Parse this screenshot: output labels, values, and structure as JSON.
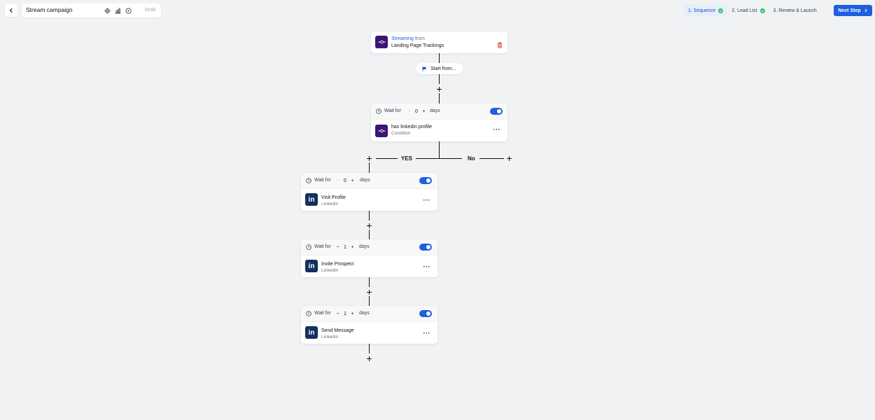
{
  "header": {
    "campaign_title": "Stream campaign",
    "status": "Draft",
    "steps": [
      {
        "label": "1. Sequence",
        "done": true,
        "active": true
      },
      {
        "label": "2. Lead List",
        "done": true,
        "active": false
      },
      {
        "label": "3. Review & Launch",
        "done": false,
        "active": false
      }
    ],
    "next_label": "Next Step"
  },
  "trigger": {
    "source_highlight": "Streaming",
    "source_suffix": "from",
    "source_name": "Landing Page Trackings",
    "start_label": "Start from..."
  },
  "condition": {
    "wait_label": "Wait for",
    "wait_value": "0",
    "wait_unit": "days",
    "title": "has linkedin profile",
    "subtitle": "Condition",
    "yes_label": "YES",
    "no_label": "No"
  },
  "actions": [
    {
      "wait_label": "Wait for",
      "wait_value": "0",
      "wait_unit": "days",
      "title": "Visit Profile",
      "subtitle": "Linkedin",
      "enabled": true
    },
    {
      "wait_label": "Wait for",
      "wait_value": "1",
      "wait_unit": "days",
      "title": "Invite Prospect",
      "subtitle": "Linkedin",
      "enabled": true
    },
    {
      "wait_label": "Wait for",
      "wait_value": "1",
      "wait_unit": "days",
      "title": "Send Message",
      "subtitle": "Linkedin",
      "enabled": true
    }
  ],
  "icons": {
    "back": "chevron-left-icon",
    "settings": "gear-icon",
    "stats": "bar-chart-icon",
    "preview": "play-icon",
    "delete": "trash-icon",
    "flag": "flag-icon",
    "clock": "clock-icon",
    "linkedin": "linkedin-icon",
    "stream": "stream-icon"
  },
  "colors": {
    "primary": "#1d5fe0",
    "success": "#22c55e",
    "danger": "#dc2626",
    "stream_bg": "#3b1673",
    "linkedin_bg": "#12315f",
    "canvas": "#f1f2f4"
  }
}
